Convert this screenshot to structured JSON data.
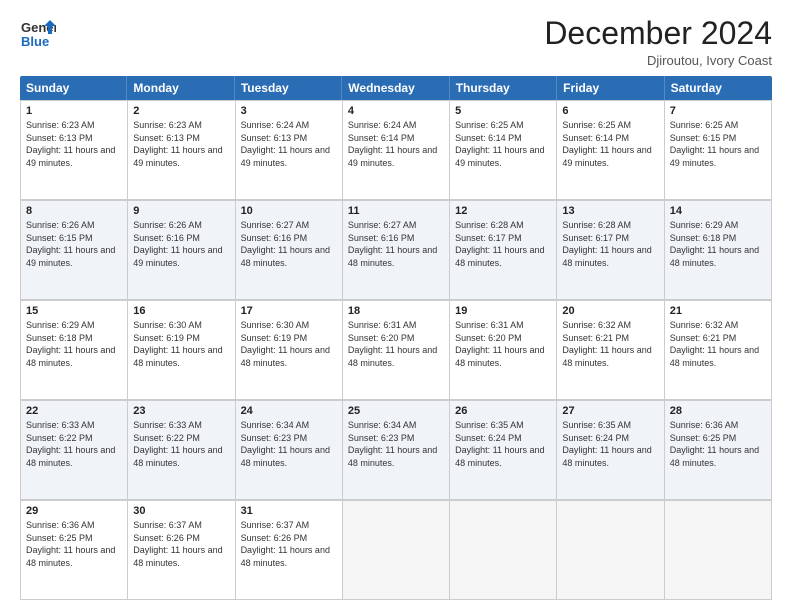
{
  "logo": {
    "general": "General",
    "blue": "Blue"
  },
  "title": "December 2024",
  "location": "Djiroutou, Ivory Coast",
  "days": [
    "Sunday",
    "Monday",
    "Tuesday",
    "Wednesday",
    "Thursday",
    "Friday",
    "Saturday"
  ],
  "weeks": [
    [
      {
        "day": "1",
        "sunrise": "6:23 AM",
        "sunset": "6:13 PM",
        "daylight": "11 hours and 49 minutes."
      },
      {
        "day": "2",
        "sunrise": "6:23 AM",
        "sunset": "6:13 PM",
        "daylight": "11 hours and 49 minutes."
      },
      {
        "day": "3",
        "sunrise": "6:24 AM",
        "sunset": "6:13 PM",
        "daylight": "11 hours and 49 minutes."
      },
      {
        "day": "4",
        "sunrise": "6:24 AM",
        "sunset": "6:14 PM",
        "daylight": "11 hours and 49 minutes."
      },
      {
        "day": "5",
        "sunrise": "6:25 AM",
        "sunset": "6:14 PM",
        "daylight": "11 hours and 49 minutes."
      },
      {
        "day": "6",
        "sunrise": "6:25 AM",
        "sunset": "6:14 PM",
        "daylight": "11 hours and 49 minutes."
      },
      {
        "day": "7",
        "sunrise": "6:25 AM",
        "sunset": "6:15 PM",
        "daylight": "11 hours and 49 minutes."
      }
    ],
    [
      {
        "day": "8",
        "sunrise": "6:26 AM",
        "sunset": "6:15 PM",
        "daylight": "11 hours and 49 minutes."
      },
      {
        "day": "9",
        "sunrise": "6:26 AM",
        "sunset": "6:16 PM",
        "daylight": "11 hours and 49 minutes."
      },
      {
        "day": "10",
        "sunrise": "6:27 AM",
        "sunset": "6:16 PM",
        "daylight": "11 hours and 48 minutes."
      },
      {
        "day": "11",
        "sunrise": "6:27 AM",
        "sunset": "6:16 PM",
        "daylight": "11 hours and 48 minutes."
      },
      {
        "day": "12",
        "sunrise": "6:28 AM",
        "sunset": "6:17 PM",
        "daylight": "11 hours and 48 minutes."
      },
      {
        "day": "13",
        "sunrise": "6:28 AM",
        "sunset": "6:17 PM",
        "daylight": "11 hours and 48 minutes."
      },
      {
        "day": "14",
        "sunrise": "6:29 AM",
        "sunset": "6:18 PM",
        "daylight": "11 hours and 48 minutes."
      }
    ],
    [
      {
        "day": "15",
        "sunrise": "6:29 AM",
        "sunset": "6:18 PM",
        "daylight": "11 hours and 48 minutes."
      },
      {
        "day": "16",
        "sunrise": "6:30 AM",
        "sunset": "6:19 PM",
        "daylight": "11 hours and 48 minutes."
      },
      {
        "day": "17",
        "sunrise": "6:30 AM",
        "sunset": "6:19 PM",
        "daylight": "11 hours and 48 minutes."
      },
      {
        "day": "18",
        "sunrise": "6:31 AM",
        "sunset": "6:20 PM",
        "daylight": "11 hours and 48 minutes."
      },
      {
        "day": "19",
        "sunrise": "6:31 AM",
        "sunset": "6:20 PM",
        "daylight": "11 hours and 48 minutes."
      },
      {
        "day": "20",
        "sunrise": "6:32 AM",
        "sunset": "6:21 PM",
        "daylight": "11 hours and 48 minutes."
      },
      {
        "day": "21",
        "sunrise": "6:32 AM",
        "sunset": "6:21 PM",
        "daylight": "11 hours and 48 minutes."
      }
    ],
    [
      {
        "day": "22",
        "sunrise": "6:33 AM",
        "sunset": "6:22 PM",
        "daylight": "11 hours and 48 minutes."
      },
      {
        "day": "23",
        "sunrise": "6:33 AM",
        "sunset": "6:22 PM",
        "daylight": "11 hours and 48 minutes."
      },
      {
        "day": "24",
        "sunrise": "6:34 AM",
        "sunset": "6:23 PM",
        "daylight": "11 hours and 48 minutes."
      },
      {
        "day": "25",
        "sunrise": "6:34 AM",
        "sunset": "6:23 PM",
        "daylight": "11 hours and 48 minutes."
      },
      {
        "day": "26",
        "sunrise": "6:35 AM",
        "sunset": "6:24 PM",
        "daylight": "11 hours and 48 minutes."
      },
      {
        "day": "27",
        "sunrise": "6:35 AM",
        "sunset": "6:24 PM",
        "daylight": "11 hours and 48 minutes."
      },
      {
        "day": "28",
        "sunrise": "6:36 AM",
        "sunset": "6:25 PM",
        "daylight": "11 hours and 48 minutes."
      }
    ],
    [
      {
        "day": "29",
        "sunrise": "6:36 AM",
        "sunset": "6:25 PM",
        "daylight": "11 hours and 48 minutes."
      },
      {
        "day": "30",
        "sunrise": "6:37 AM",
        "sunset": "6:26 PM",
        "daylight": "11 hours and 48 minutes."
      },
      {
        "day": "31",
        "sunrise": "6:37 AM",
        "sunset": "6:26 PM",
        "daylight": "11 hours and 48 minutes."
      },
      null,
      null,
      null,
      null
    ]
  ]
}
